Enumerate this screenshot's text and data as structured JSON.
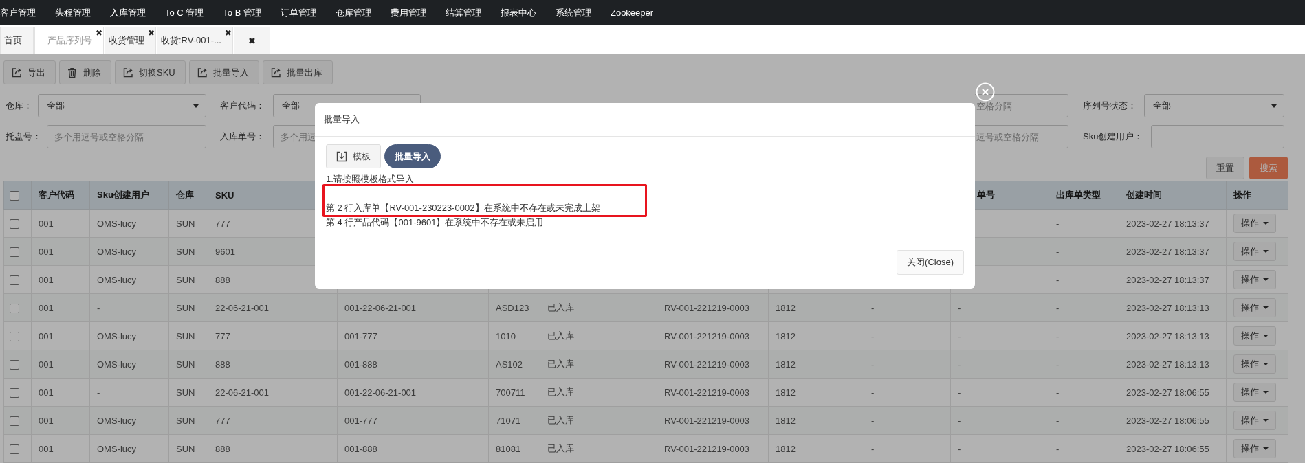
{
  "top_menu": [
    "客户管理",
    "头程管理",
    "入库管理",
    "To C 管理",
    "To B 管理",
    "订单管理",
    "仓库管理",
    "费用管理",
    "结算管理",
    "报表中心",
    "系统管理",
    "Zookeeper"
  ],
  "tabs": [
    {
      "label": "首页",
      "selected": false
    },
    {
      "label": "产品序列号",
      "close_icon": "✖",
      "selected": true
    },
    {
      "label": "收货管理",
      "close_icon": "✖",
      "selected": false
    },
    {
      "label": "收货:RV-001-...",
      "close_icon": "✖",
      "selected": false
    },
    {
      "label": "✖",
      "selected": false
    }
  ],
  "toolbar": [
    {
      "label": "导出",
      "kind": "export"
    },
    {
      "label": "删除",
      "kind": "delete"
    },
    {
      "label": "切换SKU",
      "kind": "export"
    },
    {
      "label": "批量导入",
      "kind": "export"
    },
    {
      "label": "批量出库",
      "kind": "export"
    }
  ],
  "filters": [
    [
      {
        "kind": "select",
        "label": "仓库：",
        "value": "全部"
      },
      {
        "kind": "select",
        "label": "客户代码：",
        "value": "全部"
      },
      {
        "kind": "input",
        "placeholder": "空格分隔"
      },
      {
        "kind": "select",
        "label": "序列号状态：",
        "value": "全部"
      }
    ],
    [
      {
        "kind": "input",
        "label": "托盘号：",
        "placeholder": "多个用逗号或空格分隔"
      },
      {
        "kind": "input",
        "label": "入库单号：",
        "placeholder": "多个用逗"
      },
      {
        "kind": "input",
        "placeholder": "逗号或空格分隔"
      },
      {
        "kind": "input",
        "label": "Sku创建用户："
      }
    ]
  ],
  "filter_actions": [
    {
      "label": "重置",
      "kind": "reset"
    },
    {
      "label": "搜索",
      "kind": "search"
    }
  ],
  "table": {
    "select_all_checked": false,
    "columns": [
      "客户代码",
      "Sku创建用户",
      "仓库",
      "SKU",
      "",
      "",
      "",
      "",
      "",
      "",
      "单号",
      "出库单类型",
      "创建时间",
      "操作"
    ],
    "rows": [
      {
        "checked": false,
        "cells": [
          "001",
          "OMS-lucy",
          "SUN",
          "777",
          "",
          "",
          "",
          "",
          "",
          "",
          "",
          "-",
          "2023-02-27 18:13:37",
          "操作"
        ]
      },
      {
        "checked": false,
        "cells": [
          "001",
          "OMS-lucy",
          "SUN",
          "9601",
          "",
          "",
          "",
          "",
          "",
          "",
          "",
          "-",
          "2023-02-27 18:13:37",
          "操作"
        ]
      },
      {
        "checked": false,
        "cells": [
          "001",
          "OMS-lucy",
          "SUN",
          "888",
          "",
          "",
          "",
          "",
          "",
          "",
          "",
          "-",
          "2023-02-27 18:13:37",
          "操作"
        ]
      },
      {
        "checked": false,
        "cells": [
          "001",
          "-",
          "SUN",
          "22-06-21-001",
          "001-22-06-21-001",
          "ASD123",
          "已入库",
          "RV-001-221219-0003",
          "1812",
          "-",
          "-",
          "-",
          "2023-02-27 18:13:13",
          "操作"
        ]
      },
      {
        "checked": false,
        "cells": [
          "001",
          "OMS-lucy",
          "SUN",
          "777",
          "001-777",
          "1010",
          "已入库",
          "RV-001-221219-0003",
          "1812",
          "-",
          "-",
          "-",
          "2023-02-27 18:13:13",
          "操作"
        ]
      },
      {
        "checked": false,
        "cells": [
          "001",
          "OMS-lucy",
          "SUN",
          "888",
          "001-888",
          "AS102",
          "已入库",
          "RV-001-221219-0003",
          "1812",
          "-",
          "-",
          "-",
          "2023-02-27 18:13:13",
          "操作"
        ]
      },
      {
        "checked": false,
        "cells": [
          "001",
          "-",
          "SUN",
          "22-06-21-001",
          "001-22-06-21-001",
          "700711",
          "已入库",
          "RV-001-221219-0003",
          "1812",
          "-",
          "-",
          "-",
          "2023-02-27 18:06:55",
          "操作"
        ]
      },
      {
        "checked": false,
        "cells": [
          "001",
          "OMS-lucy",
          "SUN",
          "777",
          "001-777",
          "71071",
          "已入库",
          "RV-001-221219-0003",
          "1812",
          "-",
          "-",
          "-",
          "2023-02-27 18:06:55",
          "操作"
        ]
      },
      {
        "checked": false,
        "cells": [
          "001",
          "OMS-lucy",
          "SUN",
          "888",
          "001-888",
          "81081",
          "已入库",
          "RV-001-221219-0003",
          "1812",
          "-",
          "-",
          "-",
          "2023-02-27 18:06:55",
          "操作"
        ]
      }
    ]
  },
  "modal": {
    "title": "批量导入",
    "buttons": [
      {
        "label": "模板",
        "kind": "template"
      },
      {
        "label": "批量导入",
        "kind": "import"
      }
    ],
    "hint": "1.请按照模板格式导入",
    "errors": [
      {
        "text": "第 2 行入库单【RV-001-230223-0002】在系统中不存在或未完成上架",
        "highlighted": true
      },
      {
        "text": "第 4 行产品代码【001-9601】在系统中不存在或未启用",
        "highlighted": false
      }
    ],
    "close_button": "关闭(Close)"
  }
}
